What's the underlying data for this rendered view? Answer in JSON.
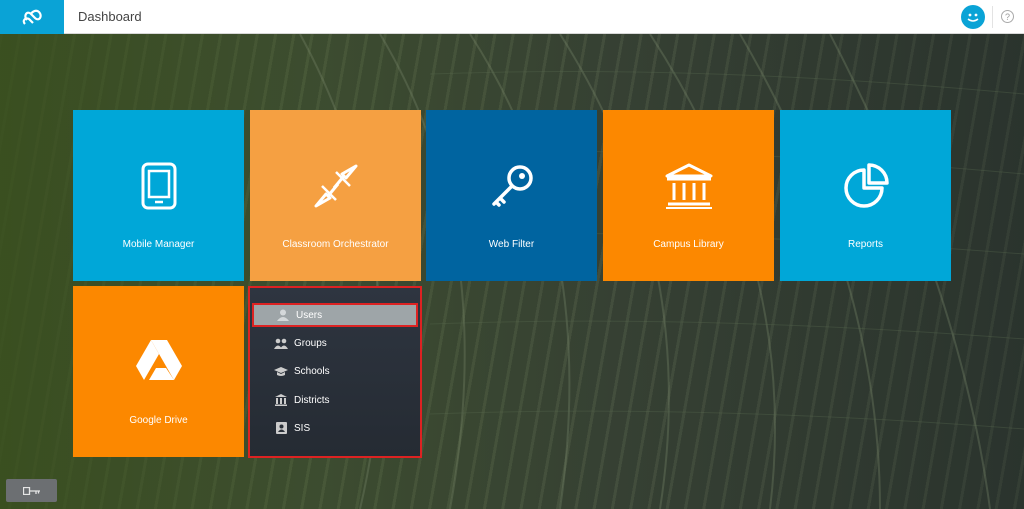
{
  "header": {
    "title": "Dashboard",
    "logo_icon": "infinity-logo-icon",
    "avatar_icon": "smiley-avatar-icon",
    "help_icon": "question-icon"
  },
  "colors": {
    "cyan": "#00a7d8",
    "light_orange": "#f5a042",
    "dark_blue": "#0064a0",
    "orange": "#fc8800",
    "menu_bg": "#2e3540",
    "highlight": "#dd2222"
  },
  "tiles": [
    {
      "label": "Mobile Manager",
      "icon": "tablet-icon"
    },
    {
      "label": "Classroom Orchestrator",
      "icon": "compass-arrows-icon"
    },
    {
      "label": "Web Filter",
      "icon": "key-icon"
    },
    {
      "label": "Campus Library",
      "icon": "library-building-icon"
    },
    {
      "label": "Reports",
      "icon": "pie-chart-icon"
    },
    {
      "label": "Google Drive",
      "icon": "google-drive-icon"
    }
  ],
  "admin_menu": {
    "items": [
      {
        "label": "Users",
        "icon": "user-icon",
        "active": true
      },
      {
        "label": "Groups",
        "icon": "users-icon"
      },
      {
        "label": "Schools",
        "icon": "graduation-cap-icon"
      },
      {
        "label": "Districts",
        "icon": "building-icon"
      },
      {
        "label": "SIS",
        "icon": "contact-card-icon"
      }
    ]
  },
  "footer": {
    "key_button_icon": "key-icon"
  }
}
